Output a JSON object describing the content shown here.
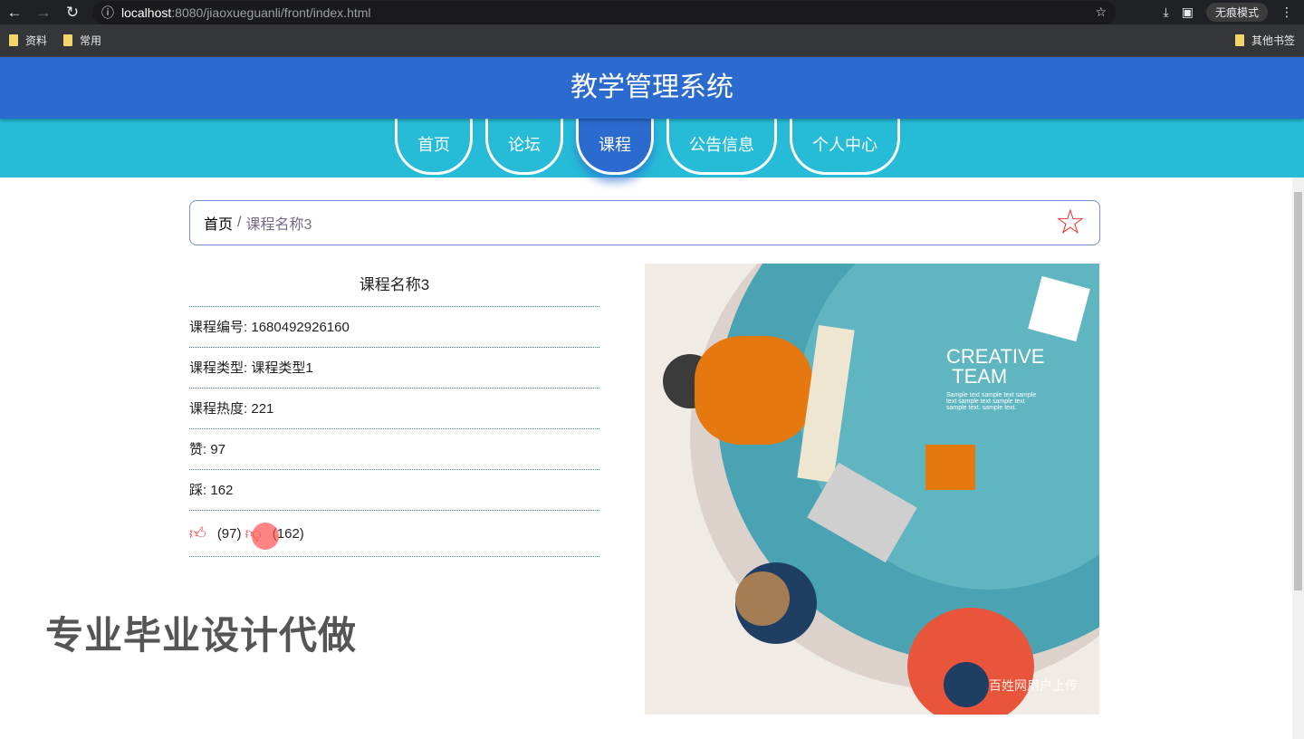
{
  "browser": {
    "url_host": "localhost",
    "url_path": ":8080/jiaoxueguanli/front/index.html",
    "incognito_label": "无痕模式",
    "bookmarks": [
      "资料",
      "常用"
    ],
    "other_bookmarks": "其他书签"
  },
  "header": {
    "title": "教学管理系统"
  },
  "nav": {
    "tabs": [
      "首页",
      "论坛",
      "课程",
      "公告信息",
      "个人中心"
    ],
    "active": "课程"
  },
  "breadcrumb": {
    "home": "首页",
    "sep": "/",
    "current": "课程名称3"
  },
  "course": {
    "title": "课程名称3",
    "fields": [
      {
        "label": "课程编号",
        "value": "1680492926160"
      },
      {
        "label": "课程类型",
        "value": "课程类型1"
      },
      {
        "label": "课程热度",
        "value": "221"
      },
      {
        "label": "赞",
        "value": "97"
      },
      {
        "label": "踩",
        "value": "162"
      }
    ],
    "like_count": "(97)",
    "dislike_count": "(162)"
  },
  "image": {
    "heading1": "CREATIVE",
    "heading2": "TEAM",
    "sample": "Sample text sample text sample text sample text sample text sample text. sample text.",
    "watermark": "百姓网用户上传"
  },
  "overlay_watermark": "专业毕业设计代做"
}
